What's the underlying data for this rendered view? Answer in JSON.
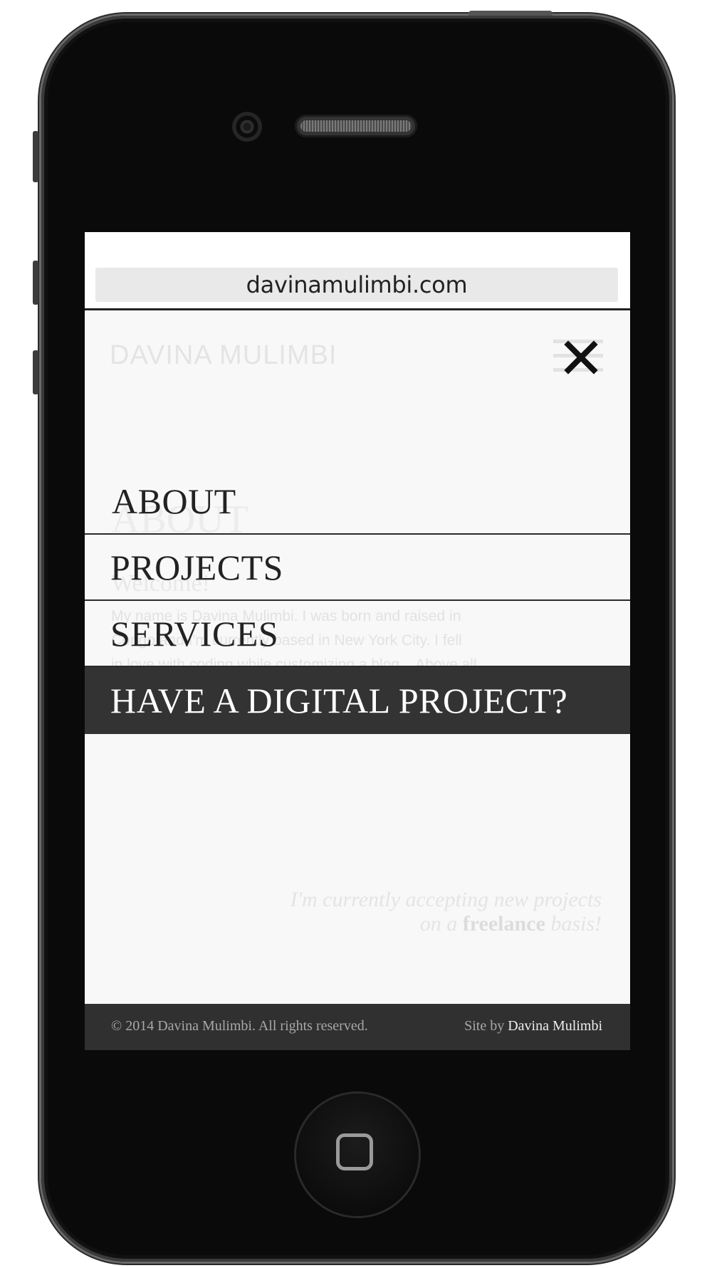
{
  "browser": {
    "url": "davinamulimbi.com"
  },
  "site": {
    "logo": "DAVINA MULIMBI",
    "background_heading": "ABOUT",
    "background_subheading": "Welcome!",
    "background_text_line1": "My name is Davina Mulimbi. I was born and raised in",
    "background_text_line2": "Congo and I'm currently based in New York City. I fell",
    "background_text_line3": "in love with coding while customizing a blog... Above all",
    "quote_line1": "I'm currently accepting new projects",
    "quote_line2_prefix": "on a",
    "quote_line2_bold": "freelance",
    "quote_line2_suffix": "basis!"
  },
  "menu": {
    "items": [
      {
        "label": "ABOUT"
      },
      {
        "label": "PROJECTS"
      },
      {
        "label": "SERVICES"
      }
    ],
    "cta_label": "HAVE A DIGITAL PROJECT?",
    "close_icon": "close-icon"
  },
  "footer": {
    "copyright": "© 2014 Davina Mulimbi. All rights reserved.",
    "site_by_prefix": "Site by",
    "site_by_author": "Davina Mulimbi"
  },
  "colors": {
    "menu_cta_bg": "#333333",
    "footer_bg": "#303030",
    "screen_bg": "#f8f8f8"
  }
}
